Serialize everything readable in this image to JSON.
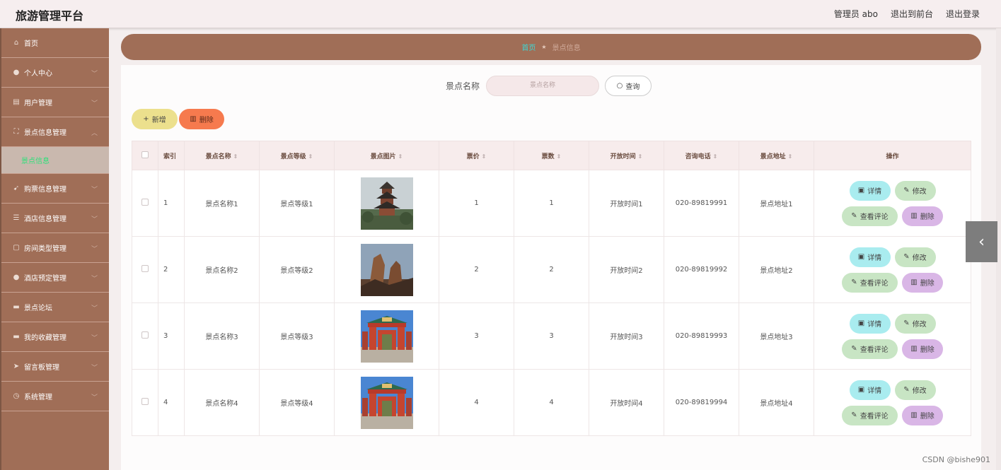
{
  "header": {
    "brand": "旅游管理平台",
    "admin": "管理员 abo",
    "to_front": "退出到前台",
    "logout": "退出登录"
  },
  "sidebar": {
    "items": [
      {
        "label": "首页",
        "icon": "home-icon",
        "glyph": "⌂"
      },
      {
        "label": "个人中心",
        "icon": "user-icon",
        "glyph": "●"
      },
      {
        "label": "用户管理",
        "icon": "users-icon",
        "glyph": "▤"
      },
      {
        "label": "景点信息管理",
        "icon": "frame-icon",
        "glyph": "⛶"
      },
      {
        "label": "景点信息",
        "submenu": true
      },
      {
        "label": "购票信息管理",
        "icon": "send-icon",
        "glyph": "➹"
      },
      {
        "label": "酒店信息管理",
        "icon": "list-icon",
        "glyph": "☰"
      },
      {
        "label": "房间类型管理",
        "icon": "chat-icon",
        "glyph": "▢"
      },
      {
        "label": "酒店预定管理",
        "icon": "cup-icon",
        "glyph": "●"
      },
      {
        "label": "景点论坛",
        "icon": "forum-icon",
        "glyph": "▬"
      },
      {
        "label": "我的收藏管理",
        "icon": "star-icon",
        "glyph": "▬"
      },
      {
        "label": "留言板管理",
        "icon": "plane-icon",
        "glyph": "➤"
      },
      {
        "label": "系统管理",
        "icon": "clock-icon",
        "glyph": "◷"
      }
    ]
  },
  "breadcrumb": {
    "home": "首页",
    "current": "景点信息"
  },
  "search": {
    "label": "景点名称",
    "placeholder": "景点名称",
    "button": "查询"
  },
  "toolbar": {
    "add": "新增",
    "delete": "删除"
  },
  "table": {
    "headers": [
      "索引",
      "景点名称",
      "景点等级",
      "景点图片",
      "票价",
      "票数",
      "开放时间",
      "咨询电话",
      "景点地址",
      "操作"
    ],
    "rows": [
      {
        "index": "1",
        "name": "景点名称1",
        "level": "景点等级1",
        "price": "1",
        "count": "1",
        "open": "开放时间1",
        "phone": "020-89819991",
        "address": "景点地址1",
        "image": "pagoda"
      },
      {
        "index": "2",
        "name": "景点名称2",
        "level": "景点等级2",
        "price": "2",
        "count": "2",
        "open": "开放时间2",
        "phone": "020-89819992",
        "address": "景点地址2",
        "image": "rock"
      },
      {
        "index": "3",
        "name": "景点名称3",
        "level": "景点等级3",
        "price": "3",
        "count": "3",
        "open": "开放时间3",
        "phone": "020-89819993",
        "address": "景点地址3",
        "image": "gate"
      },
      {
        "index": "4",
        "name": "景点名称4",
        "level": "景点等级4",
        "price": "4",
        "count": "4",
        "open": "开放时间4",
        "phone": "020-89819994",
        "address": "景点地址4",
        "image": "gate"
      }
    ],
    "actions": {
      "detail": "详情",
      "edit": "修改",
      "review": "查看评论",
      "remove": "删除"
    }
  },
  "watermark": "CSDN @bishe901",
  "colors": {
    "sidebar": "#a06e57",
    "accent_active": "#2fe07a",
    "breadcrumb_home": "#3ed6d3"
  }
}
